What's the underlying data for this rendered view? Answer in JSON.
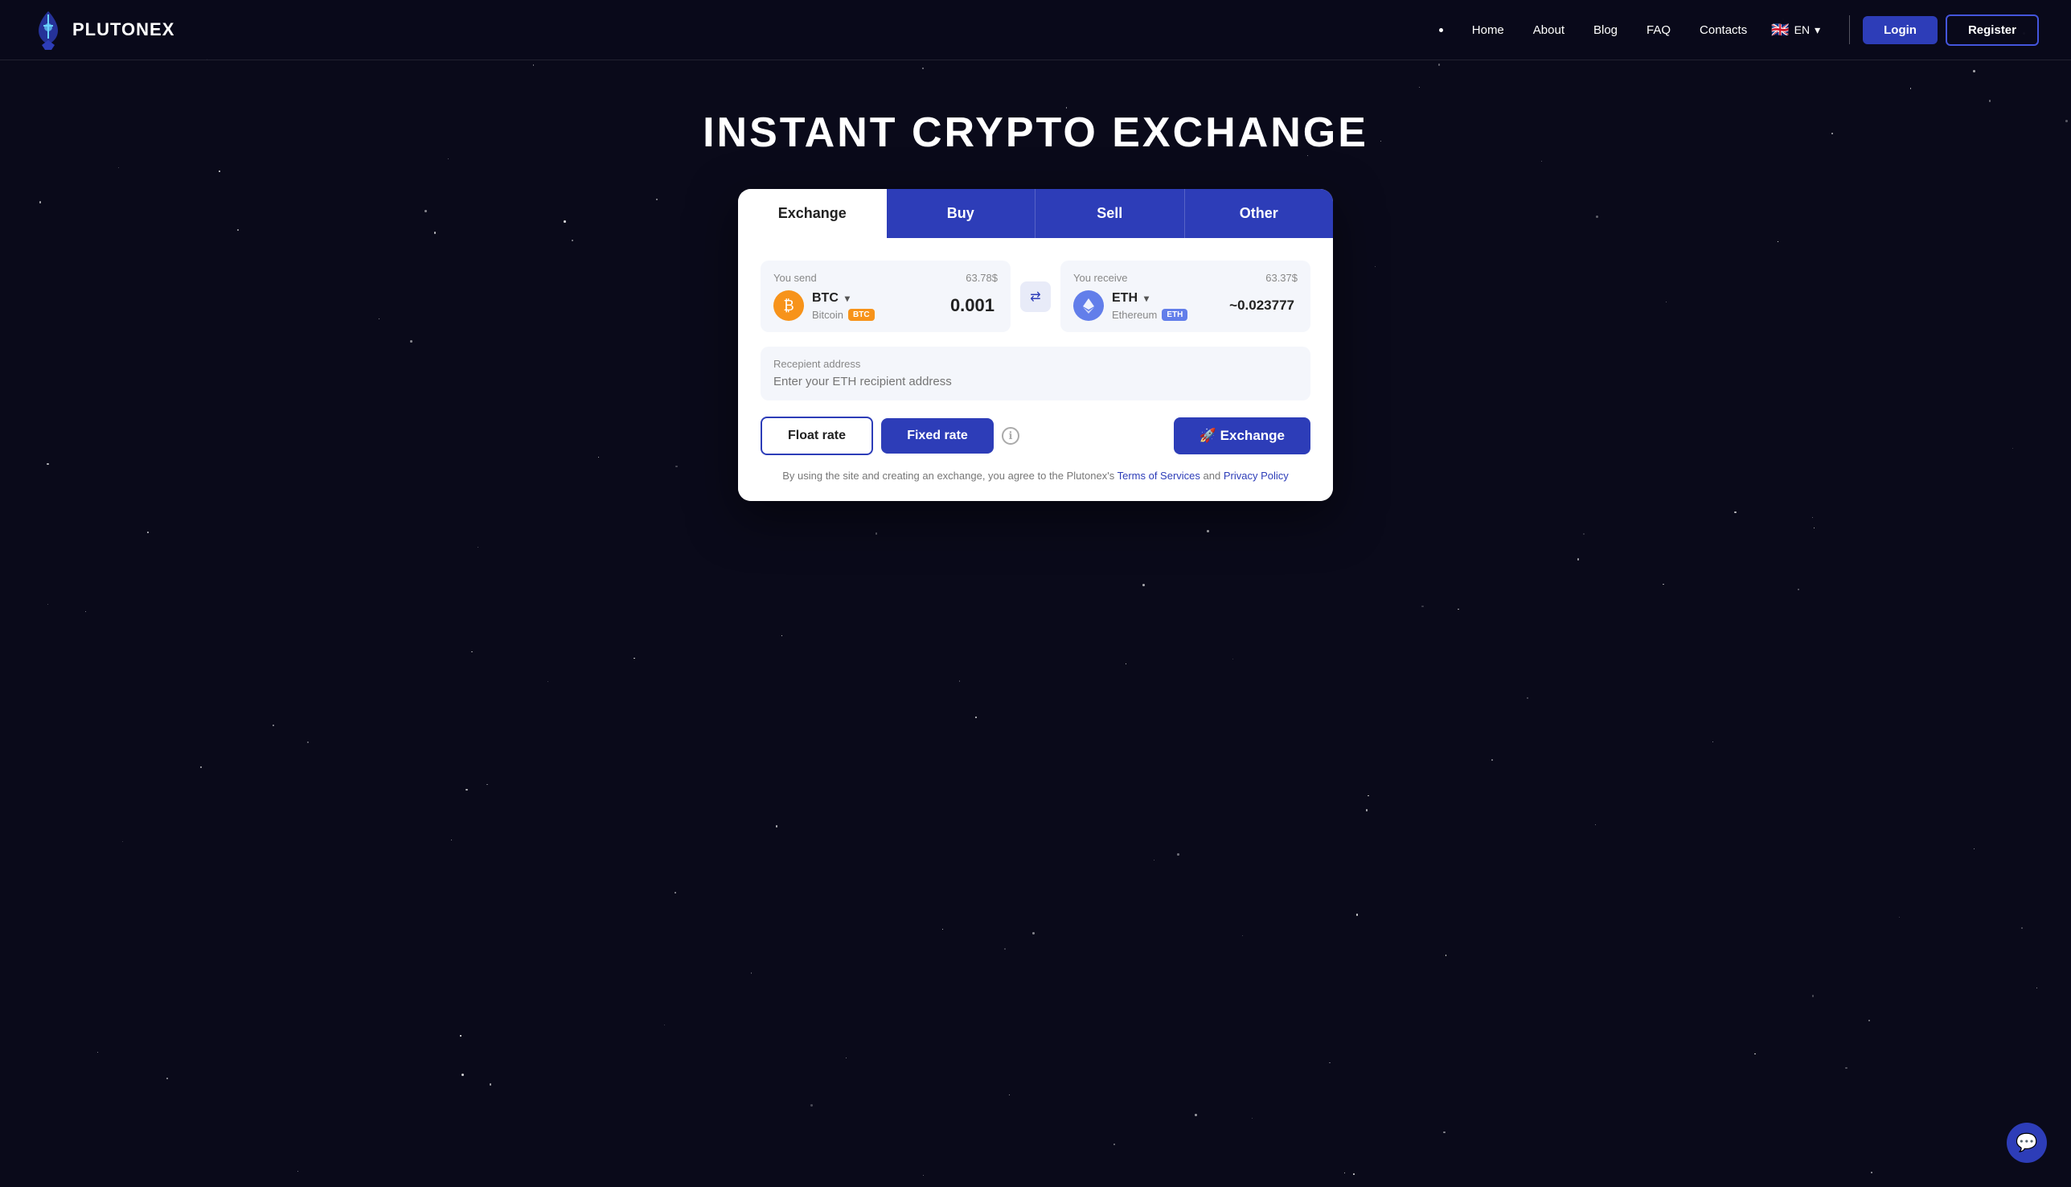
{
  "brand": {
    "name": "PLUTONEX"
  },
  "navbar": {
    "links": [
      "Home",
      "About",
      "Blog",
      "FAQ",
      "Contacts"
    ],
    "lang": "EN",
    "login_label": "Login",
    "register_label": "Register"
  },
  "hero": {
    "title": "INSTANT CRYPTO EXCHANGE"
  },
  "tabs": {
    "exchange": "Exchange",
    "buy": "Buy",
    "sell": "Sell",
    "other": "Other"
  },
  "exchange_widget": {
    "send": {
      "label": "You send",
      "usd_value": "63.78$",
      "ticker": "BTC",
      "full_name": "Bitcoin",
      "badge": "BTC",
      "amount": "0.001"
    },
    "receive": {
      "label": "You receive",
      "usd_value": "63.37$",
      "ticker": "ETH",
      "full_name": "Ethereum",
      "badge": "ETH",
      "amount": "~0.023777"
    },
    "recipient": {
      "label": "Recepient address",
      "placeholder": "Enter your ETH recipient address"
    },
    "float_rate_label": "Float rate",
    "fixed_rate_label": "Fixed rate",
    "exchange_label": "🚀 Exchange",
    "disclaimer": {
      "text": "By using the site and creating an exchange, you agree to the Plutonex's",
      "tos": "Terms of Services",
      "and": "and",
      "privacy": "Privacy Policy"
    }
  },
  "chat": {
    "icon": "💬"
  }
}
